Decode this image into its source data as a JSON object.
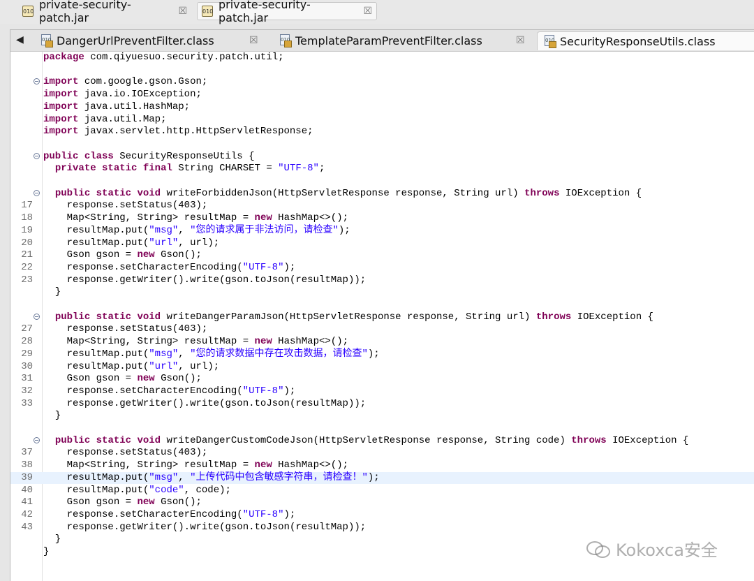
{
  "top_tabs": [
    {
      "label": "private-security-patch.jar"
    },
    {
      "label": "private-security-patch.jar"
    }
  ],
  "editor_tabs": [
    {
      "label": "DangerUrlPreventFilter.class"
    },
    {
      "label": "TemplateParamPreventFilter.class"
    },
    {
      "label": "SecurityResponseUtils.class"
    }
  ],
  "code_lines": [
    {
      "n": "",
      "fold": false,
      "t": "package com.qiyuesuo.security.patch.util;"
    },
    {
      "n": "",
      "fold": false,
      "t": ""
    },
    {
      "n": "",
      "fold": true,
      "t": "import com.google.gson.Gson;"
    },
    {
      "n": "",
      "fold": false,
      "t": "import java.io.IOException;"
    },
    {
      "n": "",
      "fold": false,
      "t": "import java.util.HashMap;"
    },
    {
      "n": "",
      "fold": false,
      "t": "import java.util.Map;"
    },
    {
      "n": "",
      "fold": false,
      "t": "import javax.servlet.http.HttpServletResponse;"
    },
    {
      "n": "",
      "fold": false,
      "t": ""
    },
    {
      "n": "",
      "fold": true,
      "t": "public class SecurityResponseUtils {"
    },
    {
      "n": "",
      "fold": false,
      "t": "  private static final String CHARSET = \"UTF-8\";"
    },
    {
      "n": "",
      "fold": false,
      "t": ""
    },
    {
      "n": "",
      "fold": true,
      "t": "  public static void writeForbiddenJson(HttpServletResponse response, String url) throws IOException {"
    },
    {
      "n": "17",
      "fold": false,
      "t": "    response.setStatus(403);"
    },
    {
      "n": "18",
      "fold": false,
      "t": "    Map<String, String> resultMap = new HashMap<>();"
    },
    {
      "n": "19",
      "fold": false,
      "t": "    resultMap.put(\"msg\", \"您的请求属于非法访问，请检查\");"
    },
    {
      "n": "20",
      "fold": false,
      "t": "    resultMap.put(\"url\", url);"
    },
    {
      "n": "21",
      "fold": false,
      "t": "    Gson gson = new Gson();"
    },
    {
      "n": "22",
      "fold": false,
      "t": "    response.setCharacterEncoding(\"UTF-8\");"
    },
    {
      "n": "23",
      "fold": false,
      "t": "    response.getWriter().write(gson.toJson(resultMap));"
    },
    {
      "n": "",
      "fold": false,
      "t": "  }"
    },
    {
      "n": "",
      "fold": false,
      "t": ""
    },
    {
      "n": "",
      "fold": true,
      "t": "  public static void writeDangerParamJson(HttpServletResponse response, String url) throws IOException {"
    },
    {
      "n": "27",
      "fold": false,
      "t": "    response.setStatus(403);"
    },
    {
      "n": "28",
      "fold": false,
      "t": "    Map<String, String> resultMap = new HashMap<>();"
    },
    {
      "n": "29",
      "fold": false,
      "t": "    resultMap.put(\"msg\", \"您的请求数据中存在攻击数据，请检查\");"
    },
    {
      "n": "30",
      "fold": false,
      "t": "    resultMap.put(\"url\", url);"
    },
    {
      "n": "31",
      "fold": false,
      "t": "    Gson gson = new Gson();"
    },
    {
      "n": "32",
      "fold": false,
      "t": "    response.setCharacterEncoding(\"UTF-8\");"
    },
    {
      "n": "33",
      "fold": false,
      "t": "    response.getWriter().write(gson.toJson(resultMap));"
    },
    {
      "n": "",
      "fold": false,
      "t": "  }"
    },
    {
      "n": "",
      "fold": false,
      "t": ""
    },
    {
      "n": "",
      "fold": true,
      "t": "  public static void writeDangerCustomCodeJson(HttpServletResponse response, String code) throws IOException {"
    },
    {
      "n": "37",
      "fold": false,
      "t": "    response.setStatus(403);"
    },
    {
      "n": "38",
      "fold": false,
      "t": "    Map<String, String> resultMap = new HashMap<>();"
    },
    {
      "n": "39",
      "fold": false,
      "hl": true,
      "t": "    resultMap.put(\"msg\", \"上传代码中包含敏感字符串，请检查！\");"
    },
    {
      "n": "40",
      "fold": false,
      "t": "    resultMap.put(\"code\", code);"
    },
    {
      "n": "41",
      "fold": false,
      "t": "    Gson gson = new Gson();"
    },
    {
      "n": "42",
      "fold": false,
      "t": "    response.setCharacterEncoding(\"UTF-8\");"
    },
    {
      "n": "43",
      "fold": false,
      "t": "    response.getWriter().write(gson.toJson(resultMap));"
    },
    {
      "n": "",
      "fold": false,
      "t": "  }"
    },
    {
      "n": "",
      "fold": false,
      "t": "}"
    }
  ],
  "keywords": [
    "package",
    "import",
    "public",
    "class",
    "private",
    "static",
    "final",
    "void",
    "throws",
    "new"
  ],
  "colors": {
    "keyword": "#7f0055",
    "string": "#2a00ff",
    "highlight_line": "#e8f2fe"
  },
  "watermark": {
    "text": "Kokoxca安全"
  }
}
